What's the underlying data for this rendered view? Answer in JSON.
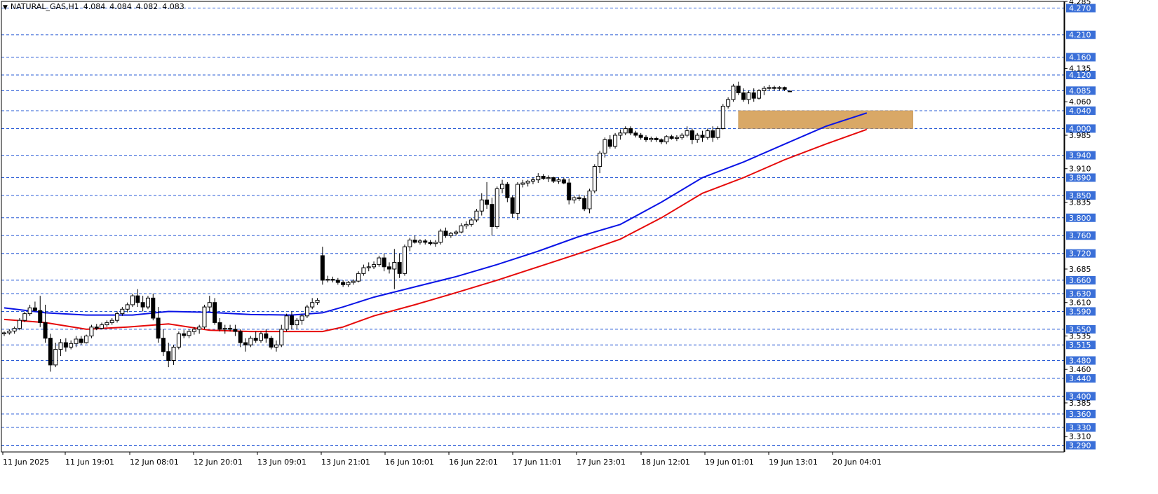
{
  "header": {
    "symbol_timeframe": "NATURAL_GAS,H1",
    "open": "4.084",
    "high": "4.084",
    "low": "4.082",
    "close": "4.083"
  },
  "colors": {
    "background": "#ffffff",
    "candle_border": "#000000",
    "bull_fill": "#ffffff",
    "bear_fill": "#000000",
    "ma_fast": "#0a14e6",
    "ma_slow": "#e60a0a",
    "level_line": "#2a5cd6",
    "level_badge": "#3a6fd8",
    "zone_fill": "#d9a866"
  },
  "chart_data": {
    "type": "candlestick",
    "title": "NATURAL_GAS,H1",
    "ylim": [
      3.275,
      4.285
    ],
    "grid": false,
    "x_tick_labels": [
      "11 Jun 2025",
      "11 Jun 19:01",
      "12 Jun 08:01",
      "12 Jun 20:01",
      "13 Jun 09:01",
      "13 Jun 21:01",
      "16 Jun 10:01",
      "16 Jun 22:01",
      "17 Jun 11:01",
      "17 Jun 23:01",
      "18 Jun 12:01",
      "19 Jun 01:01",
      "19 Jun 13:01",
      "20 Jun 04:01"
    ],
    "y_tick_labels": [
      "4.285",
      "4.135",
      "4.060",
      "3.985",
      "3.910",
      "3.835",
      "3.685",
      "3.610",
      "3.535",
      "3.460",
      "3.385",
      "3.310"
    ],
    "horizontal_levels": [
      "4.270",
      "4.210",
      "4.160",
      "4.120",
      "4.085",
      "4.040",
      "4.000",
      "3.940",
      "3.890",
      "3.850",
      "3.800",
      "3.760",
      "3.720",
      "3.660",
      "3.630",
      "3.590",
      "3.550",
      "3.515",
      "3.480",
      "3.440",
      "3.400",
      "3.360",
      "3.330",
      "3.290"
    ],
    "current_price": "4.085",
    "zone": {
      "from": 4.0,
      "to": 4.04
    },
    "series": [
      {
        "type": "ohlc",
        "x_start": "11 Jun 2025",
        "interval": "1H",
        "ohlc": [
          [
            3.54,
            3.545,
            3.535,
            3.542
          ],
          [
            3.542,
            3.55,
            3.538,
            3.546
          ],
          [
            3.546,
            3.556,
            3.54,
            3.552
          ],
          [
            3.552,
            3.575,
            3.548,
            3.57
          ],
          [
            3.57,
            3.59,
            3.566,
            3.585
          ],
          [
            3.585,
            3.605,
            3.58,
            3.598
          ],
          [
            3.598,
            3.612,
            3.59,
            3.592
          ],
          [
            3.592,
            3.625,
            3.555,
            3.565
          ],
          [
            3.565,
            3.605,
            3.52,
            3.53
          ],
          [
            3.53,
            3.54,
            3.455,
            3.47
          ],
          [
            3.47,
            3.52,
            3.465,
            3.505
          ],
          [
            3.505,
            3.528,
            3.49,
            3.52
          ],
          [
            3.52,
            3.53,
            3.5,
            3.51
          ],
          [
            3.51,
            3.525,
            3.505,
            3.518
          ],
          [
            3.518,
            3.535,
            3.51,
            3.528
          ],
          [
            3.528,
            3.535,
            3.515,
            3.52
          ],
          [
            3.52,
            3.538,
            3.518,
            3.535
          ],
          [
            3.535,
            3.56,
            3.53,
            3.555
          ],
          [
            3.555,
            3.562,
            3.548,
            3.552
          ],
          [
            3.552,
            3.565,
            3.55,
            3.56
          ],
          [
            3.56,
            3.57,
            3.555,
            3.565
          ],
          [
            3.565,
            3.575,
            3.56,
            3.57
          ],
          [
            3.57,
            3.59,
            3.565,
            3.585
          ],
          [
            3.585,
            3.6,
            3.58,
            3.595
          ],
          [
            3.595,
            3.61,
            3.588,
            3.605
          ],
          [
            3.605,
            3.63,
            3.6,
            3.625
          ],
          [
            3.625,
            3.64,
            3.6,
            3.61
          ],
          [
            3.61,
            3.625,
            3.59,
            3.6
          ],
          [
            3.6,
            3.625,
            3.595,
            3.62
          ],
          [
            3.62,
            3.63,
            3.57,
            3.575
          ],
          [
            3.575,
            3.6,
            3.52,
            3.53
          ],
          [
            3.53,
            3.55,
            3.49,
            3.5
          ],
          [
            3.5,
            3.52,
            3.465,
            3.48
          ],
          [
            3.48,
            3.515,
            3.47,
            3.51
          ],
          [
            3.51,
            3.545,
            3.505,
            3.54
          ],
          [
            3.54,
            3.548,
            3.53,
            3.536
          ],
          [
            3.536,
            3.55,
            3.53,
            3.545
          ],
          [
            3.545,
            3.555,
            3.538,
            3.55
          ],
          [
            3.55,
            3.56,
            3.54,
            3.555
          ],
          [
            3.555,
            3.605,
            3.55,
            3.6
          ],
          [
            3.6,
            3.625,
            3.59,
            3.61
          ],
          [
            3.61,
            3.62,
            3.56,
            3.565
          ],
          [
            3.565,
            3.575,
            3.545,
            3.55
          ],
          [
            3.55,
            3.56,
            3.54,
            3.552
          ],
          [
            3.552,
            3.56,
            3.545,
            3.55
          ],
          [
            3.55,
            3.56,
            3.535,
            3.545
          ],
          [
            3.545,
            3.55,
            3.51,
            3.52
          ],
          [
            3.52,
            3.53,
            3.5,
            3.515
          ],
          [
            3.515,
            3.535,
            3.51,
            3.53
          ],
          [
            3.53,
            3.545,
            3.52,
            3.525
          ],
          [
            3.525,
            3.545,
            3.52,
            3.54
          ],
          [
            3.54,
            3.55,
            3.52,
            3.53
          ],
          [
            3.53,
            3.535,
            3.505,
            3.51
          ],
          [
            3.51,
            3.525,
            3.5,
            3.515
          ],
          [
            3.515,
            3.56,
            3.51,
            3.55
          ],
          [
            3.55,
            3.585,
            3.545,
            3.58
          ],
          [
            3.58,
            3.59,
            3.55,
            3.56
          ],
          [
            3.56,
            3.575,
            3.55,
            3.57
          ],
          [
            3.57,
            3.585,
            3.56,
            3.58
          ],
          [
            3.58,
            3.605,
            3.575,
            3.6
          ],
          [
            3.6,
            3.62,
            3.595,
            3.61
          ],
          [
            3.61,
            3.62,
            3.605,
            3.615
          ],
          [
            3.715,
            3.735,
            3.65,
            3.66
          ],
          [
            3.66,
            3.67,
            3.655,
            3.662
          ],
          [
            3.662,
            3.668,
            3.655,
            3.66
          ],
          [
            3.66,
            3.665,
            3.65,
            3.655
          ],
          [
            3.655,
            3.66,
            3.645,
            3.65
          ],
          [
            3.65,
            3.658,
            3.645,
            3.655
          ],
          [
            3.655,
            3.662,
            3.65,
            3.658
          ],
          [
            3.658,
            3.68,
            3.655,
            3.675
          ],
          [
            3.675,
            3.695,
            3.67,
            3.688
          ],
          [
            3.688,
            3.7,
            3.68,
            3.69
          ],
          [
            3.69,
            3.702,
            3.685,
            3.695
          ],
          [
            3.695,
            3.715,
            3.69,
            3.71
          ],
          [
            3.71,
            3.72,
            3.68,
            3.69
          ],
          [
            3.69,
            3.7,
            3.675,
            3.685
          ],
          [
            3.685,
            3.73,
            3.64,
            3.7
          ],
          [
            3.7,
            3.72,
            3.665,
            3.675
          ],
          [
            3.675,
            3.74,
            3.67,
            3.735
          ],
          [
            3.735,
            3.755,
            3.725,
            3.75
          ],
          [
            3.75,
            3.76,
            3.742,
            3.745
          ],
          [
            3.745,
            3.752,
            3.74,
            3.748
          ],
          [
            3.748,
            3.752,
            3.74,
            3.745
          ],
          [
            3.745,
            3.75,
            3.738,
            3.742
          ],
          [
            3.742,
            3.75,
            3.735,
            3.745
          ],
          [
            3.745,
            3.775,
            3.74,
            3.77
          ],
          [
            3.77,
            3.778,
            3.755,
            3.76
          ],
          [
            3.76,
            3.768,
            3.755,
            3.765
          ],
          [
            3.765,
            3.772,
            3.76,
            3.768
          ],
          [
            3.768,
            3.788,
            3.765,
            3.782
          ],
          [
            3.782,
            3.792,
            3.775,
            3.785
          ],
          [
            3.785,
            3.8,
            3.78,
            3.795
          ],
          [
            3.795,
            3.82,
            3.79,
            3.815
          ],
          [
            3.815,
            3.855,
            3.805,
            3.84
          ],
          [
            3.84,
            3.88,
            3.82,
            3.83
          ],
          [
            3.83,
            3.845,
            3.76,
            3.78
          ],
          [
            3.78,
            3.87,
            3.775,
            3.865
          ],
          [
            3.865,
            3.885,
            3.855,
            3.875
          ],
          [
            3.875,
            3.88,
            3.835,
            3.845
          ],
          [
            3.845,
            3.85,
            3.8,
            3.81
          ],
          [
            3.81,
            3.88,
            3.795,
            3.875
          ],
          [
            3.875,
            3.885,
            3.868,
            3.878
          ],
          [
            3.878,
            3.885,
            3.87,
            3.882
          ],
          [
            3.882,
            3.89,
            3.875,
            3.885
          ],
          [
            3.885,
            3.9,
            3.878,
            3.893
          ],
          [
            3.893,
            3.898,
            3.885,
            3.888
          ],
          [
            3.888,
            3.895,
            3.88,
            3.89
          ],
          [
            3.89,
            3.892,
            3.878,
            3.882
          ],
          [
            3.882,
            3.89,
            3.876,
            3.885
          ],
          [
            3.885,
            3.89,
            3.875,
            3.878
          ],
          [
            3.878,
            3.888,
            3.83,
            3.84
          ],
          [
            3.84,
            3.85,
            3.832,
            3.845
          ],
          [
            3.845,
            3.852,
            3.838,
            3.843
          ],
          [
            3.843,
            3.85,
            3.815,
            3.82
          ],
          [
            3.82,
            3.865,
            3.81,
            3.86
          ],
          [
            3.86,
            3.92,
            3.855,
            3.915
          ],
          [
            3.915,
            3.95,
            3.9,
            3.945
          ],
          [
            3.945,
            3.98,
            3.935,
            3.975
          ],
          [
            3.975,
            3.985,
            3.955,
            3.96
          ],
          [
            3.96,
            3.99,
            3.955,
            3.985
          ],
          [
            3.985,
            3.998,
            3.975,
            3.99
          ],
          [
            3.99,
            4.005,
            3.985,
            4.0
          ],
          [
            4.0,
            4.005,
            3.985,
            3.99
          ],
          [
            3.99,
            3.995,
            3.98,
            3.985
          ],
          [
            3.985,
            3.99,
            3.975,
            3.98
          ],
          [
            3.98,
            3.985,
            3.97,
            3.975
          ],
          [
            3.975,
            3.982,
            3.97,
            3.978
          ],
          [
            3.978,
            3.982,
            3.97,
            3.975
          ],
          [
            3.975,
            3.978,
            3.965,
            3.97
          ],
          [
            3.97,
            3.985,
            3.965,
            3.982
          ],
          [
            3.982,
            3.986,
            3.975,
            3.978
          ],
          [
            3.978,
            3.985,
            3.972,
            3.98
          ],
          [
            3.98,
            3.99,
            3.975,
            3.985
          ],
          [
            3.985,
            4.005,
            3.98,
            3.995
          ],
          [
            3.995,
            4.0,
            3.965,
            3.975
          ],
          [
            3.975,
            3.99,
            3.968,
            3.985
          ],
          [
            3.985,
            3.995,
            3.97,
            3.98
          ],
          [
            3.98,
            4.0,
            3.975,
            3.995
          ],
          [
            3.995,
            4.005,
            3.97,
            3.98
          ],
          [
            3.98,
            4.005,
            3.975,
            4.0
          ],
          [
            4.0,
            4.055,
            3.998,
            4.05
          ],
          [
            4.05,
            4.07,
            4.045,
            4.065
          ],
          [
            4.065,
            4.1,
            4.06,
            4.095
          ],
          [
            4.095,
            4.105,
            4.075,
            4.08
          ],
          [
            4.08,
            4.09,
            4.06,
            4.065
          ],
          [
            4.065,
            4.085,
            4.055,
            4.08
          ],
          [
            4.08,
            4.09,
            4.06,
            4.068
          ],
          [
            4.068,
            4.088,
            4.065,
            4.085
          ],
          [
            4.085,
            4.095,
            4.075,
            4.09
          ],
          [
            4.09,
            4.098,
            4.085,
            4.092
          ],
          [
            4.092,
            4.096,
            4.085,
            4.09
          ],
          [
            4.09,
            4.095,
            4.085,
            4.092
          ],
          [
            4.092,
            4.094,
            4.084,
            4.088
          ],
          [
            4.084,
            4.084,
            4.082,
            4.083
          ]
        ]
      },
      {
        "type": "line",
        "role": "ma_fast",
        "color": "blue",
        "points": [
          [
            0,
            3.598
          ],
          [
            8,
            3.587
          ],
          [
            16,
            3.582
          ],
          [
            25,
            3.582
          ],
          [
            32,
            3.59
          ],
          [
            40,
            3.588
          ],
          [
            48,
            3.583
          ],
          [
            56,
            3.582
          ],
          [
            62,
            3.587
          ],
          [
            66,
            3.6
          ],
          [
            72,
            3.622
          ],
          [
            80,
            3.645
          ],
          [
            88,
            3.668
          ],
          [
            96,
            3.695
          ],
          [
            104,
            3.725
          ],
          [
            112,
            3.758
          ],
          [
            120,
            3.785
          ],
          [
            128,
            3.835
          ],
          [
            136,
            3.89
          ],
          [
            144,
            3.925
          ],
          [
            152,
            3.965
          ],
          [
            160,
            4.005
          ],
          [
            168,
            4.035
          ]
        ]
      },
      {
        "type": "line",
        "role": "ma_slow",
        "color": "red",
        "points": [
          [
            0,
            3.572
          ],
          [
            8,
            3.565
          ],
          [
            16,
            3.55
          ],
          [
            24,
            3.555
          ],
          [
            32,
            3.562
          ],
          [
            40,
            3.548
          ],
          [
            48,
            3.545
          ],
          [
            56,
            3.545
          ],
          [
            62,
            3.545
          ],
          [
            66,
            3.555
          ],
          [
            72,
            3.58
          ],
          [
            80,
            3.605
          ],
          [
            88,
            3.632
          ],
          [
            96,
            3.66
          ],
          [
            104,
            3.69
          ],
          [
            112,
            3.72
          ],
          [
            120,
            3.752
          ],
          [
            128,
            3.8
          ],
          [
            136,
            3.855
          ],
          [
            144,
            3.89
          ],
          [
            152,
            3.93
          ],
          [
            160,
            3.965
          ],
          [
            168,
            3.998
          ]
        ]
      }
    ]
  }
}
